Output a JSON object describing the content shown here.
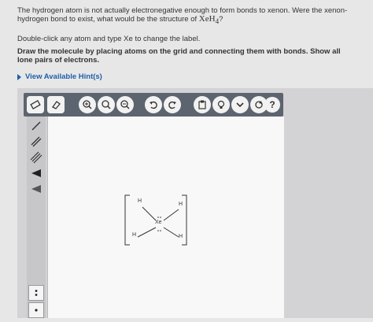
{
  "question": {
    "text_before": "The hydrogen atom is not actually electronegative enough to form bonds to xenon. Were the xenon-hydrogen bond to exist, what would be the structure of ",
    "formula": "XeH",
    "subscript": "4",
    "text_after": "?"
  },
  "instruction_doubleclick": "Double-click any atom and type Xe to change the label.",
  "instruction_draw": "Draw the molecule by placing atoms on the grid and connecting them with bonds. Show all lone pairs of electrons.",
  "hint_label": "View Available Hint(s)",
  "toolbar": {
    "buttons": [
      "eraser-icon",
      "zoom-in-icon",
      "zoom-out-icon",
      "undo-icon",
      "redo-icon",
      "clipboard-icon",
      "lightbulb-icon",
      "chevron-down-icon",
      "refresh-icon",
      "help-icon"
    ],
    "help_label": "?"
  },
  "molecule": {
    "center": "Xe",
    "ligands": [
      "H",
      "H",
      "H",
      "H"
    ]
  },
  "colors": {
    "toolbar_bg": "#5c646f",
    "hint_link": "#1f5fa8",
    "canvas_bg": "#f8f8f8"
  }
}
